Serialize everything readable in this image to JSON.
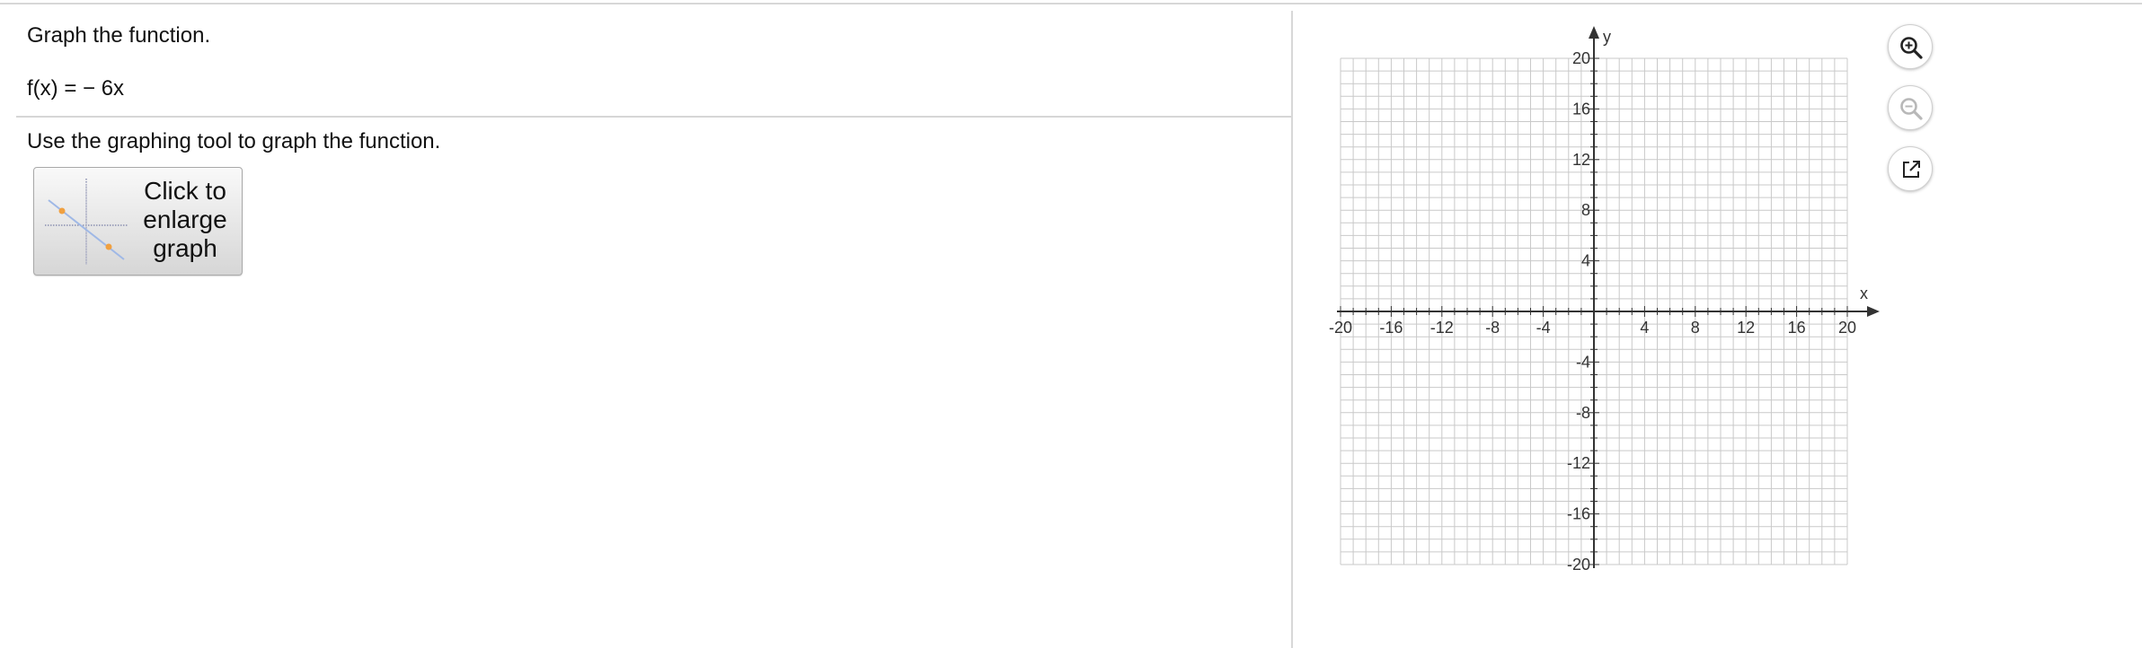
{
  "question": {
    "instruction": "Graph the function.",
    "function_text": "f(x) = − 6x",
    "tool_instruction": "Use the graphing tool to graph the function."
  },
  "enlarge_button": {
    "label": "Click to enlarge graph"
  },
  "toolbar": {
    "zoom_in_icon": "zoom-in-icon",
    "zoom_out_icon": "zoom-out-icon",
    "popout_icon": "external-link-icon"
  },
  "colors": {
    "grid": "#c9c9c9",
    "axis": "#333333",
    "thumbnail_line": "#9fb8e6",
    "thumbnail_point": "#f0a040"
  },
  "chart_data": {
    "type": "scatter",
    "xlabel": "x",
    "ylabel": "y",
    "xlim": [
      -20,
      20
    ],
    "ylim": [
      -20,
      20
    ],
    "grid": true,
    "grid_step": 1,
    "x_ticks": [
      -20,
      -16,
      -12,
      -8,
      -4,
      4,
      8,
      12,
      16,
      20
    ],
    "y_ticks": [
      20,
      16,
      12,
      8,
      4,
      -4,
      -8,
      -12,
      -16,
      -20
    ],
    "x_tick_labels": [
      "-20",
      "-16",
      "-12",
      "-8",
      "-4",
      "4",
      "8",
      "12",
      "16",
      "20"
    ],
    "y_tick_labels": [
      "20",
      "16",
      "12",
      "8",
      "4",
      "-4",
      "-8",
      "-12",
      "-16",
      "-20"
    ]
  }
}
